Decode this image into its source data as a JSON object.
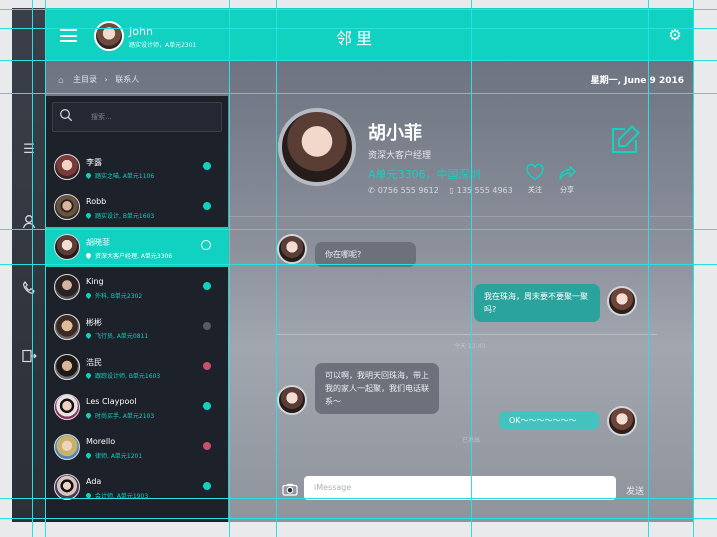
{
  "header": {
    "user_name": "John",
    "user_subtitle": "踏实设计师，A单元2301",
    "title": "邻里",
    "menu_icon": "hamburger-menu-icon",
    "settings_icon": "gear-icon"
  },
  "breadcrumb": {
    "home": "主目录",
    "separator": "›",
    "current": "联系人"
  },
  "date": "星期一, June 9  2016",
  "search": {
    "placeholder": "搜索..."
  },
  "contacts": [
    {
      "name": "李露",
      "sub": "踏实之喵, A单元1106",
      "status": "teal"
    },
    {
      "name": "Robb",
      "sub": "踏实设计, B单元1603",
      "status": "teal"
    },
    {
      "name": "胡晓菲",
      "sub": "资深大客户经理, A单元3306",
      "status": "active-ring"
    },
    {
      "name": "King",
      "sub": "外科, B单元2302",
      "status": "teal"
    },
    {
      "name": "彬彬",
      "sub": "飞行员, A单元0811",
      "status": "gray"
    },
    {
      "name": "浩民",
      "sub": "跟踪设计师, B单元1603",
      "status": "pink"
    },
    {
      "name": "Les Claypool",
      "sub": "时尚买手, A单元2103",
      "status": "teal"
    },
    {
      "name": "Morello",
      "sub": "律师, A单元1201",
      "status": "pink"
    },
    {
      "name": "Ada",
      "sub": "会计师, A单元1903",
      "status": "teal"
    }
  ],
  "profile": {
    "name": "胡小菲",
    "title": "资深大客户经理",
    "address": "A单元3306，中国深圳",
    "phone1": "0756 555 9612",
    "phone2": "135 555 4963",
    "follow_label": "关注",
    "share_label": "分享",
    "edit_icon": "edit-icon"
  },
  "messages": [
    {
      "text": "你在哪呢?",
      "direction": "in"
    },
    {
      "text": "我在珠海，周末要不要聚一聚吗?",
      "direction": "out"
    },
    {
      "text": "可以啊，我明天回珠海，带上我的家人一起聚，我们电话联系～",
      "direction": "in"
    },
    {
      "text": "OK～～～～～～～",
      "direction": "out"
    }
  ],
  "divider_time": "今天 13:40",
  "read_status": "已发出",
  "compose": {
    "placeholder": "iMessage",
    "send_label": "发送"
  },
  "colors": {
    "accent": "#11d1c1",
    "panel": "#1d2129",
    "dot_teal": "#11d1c1",
    "dot_gray": "#565b67",
    "dot_pink": "#c94f6a"
  }
}
